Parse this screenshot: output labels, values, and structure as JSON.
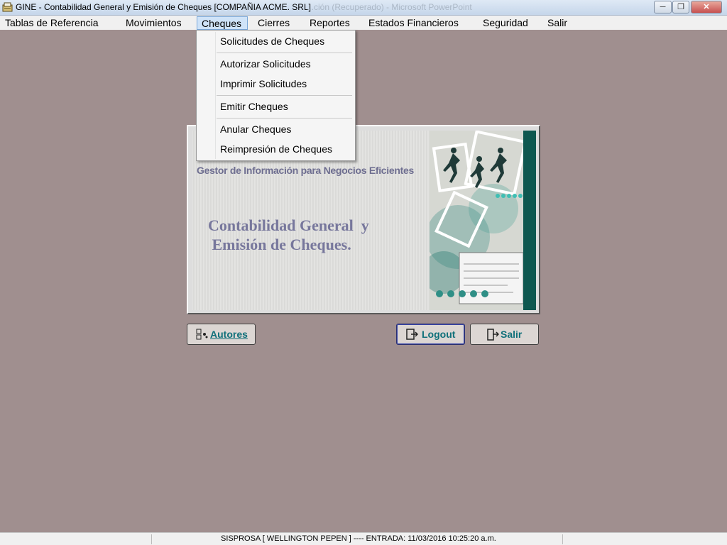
{
  "window": {
    "title": "GINE - Contabilidad General y Emisión de Cheques [COMPAÑIA ACME. SRL]",
    "background_title": "...ción (Recuperado) - Microsoft PowerPoint",
    "minimize": "─",
    "maximize": "❐",
    "close": "✕"
  },
  "menubar": {
    "items": [
      {
        "label": "Tablas de Referencia"
      },
      {
        "label": "Movimientos"
      },
      {
        "label": "Cheques"
      },
      {
        "label": "Cierres"
      },
      {
        "label": "Reportes"
      },
      {
        "label": "Estados Financieros"
      },
      {
        "label": "Seguridad"
      },
      {
        "label": "Salir"
      }
    ],
    "active": "Cheques"
  },
  "dropdown": {
    "items": [
      {
        "label": "Solicitudes de Cheques"
      },
      {
        "label": "Autorizar Solicitudes"
      },
      {
        "label": "Imprimir Solicitudes"
      },
      {
        "label": "Emitir Cheques"
      },
      {
        "label": "Anular Cheques"
      },
      {
        "label": "Reimpresión de Cheques"
      }
    ]
  },
  "splash": {
    "tagline": "Gestor de Información para Negocios Eficientes",
    "headline": "Contabilidad General  y\n Emisión de Cheques."
  },
  "buttons": {
    "autores": "Autores",
    "logout": "Logout",
    "salir": "Salir"
  },
  "statusbar": {
    "text": "SISPROSA [ WELLINGTON PEPEN ] ---- ENTRADA: 11/03/2016 10:25:20 a.m."
  },
  "colors": {
    "desktop": "#a08f8f",
    "button_text": "#10707a",
    "splash_accent": "#0f5850",
    "headline": "#77779c"
  }
}
